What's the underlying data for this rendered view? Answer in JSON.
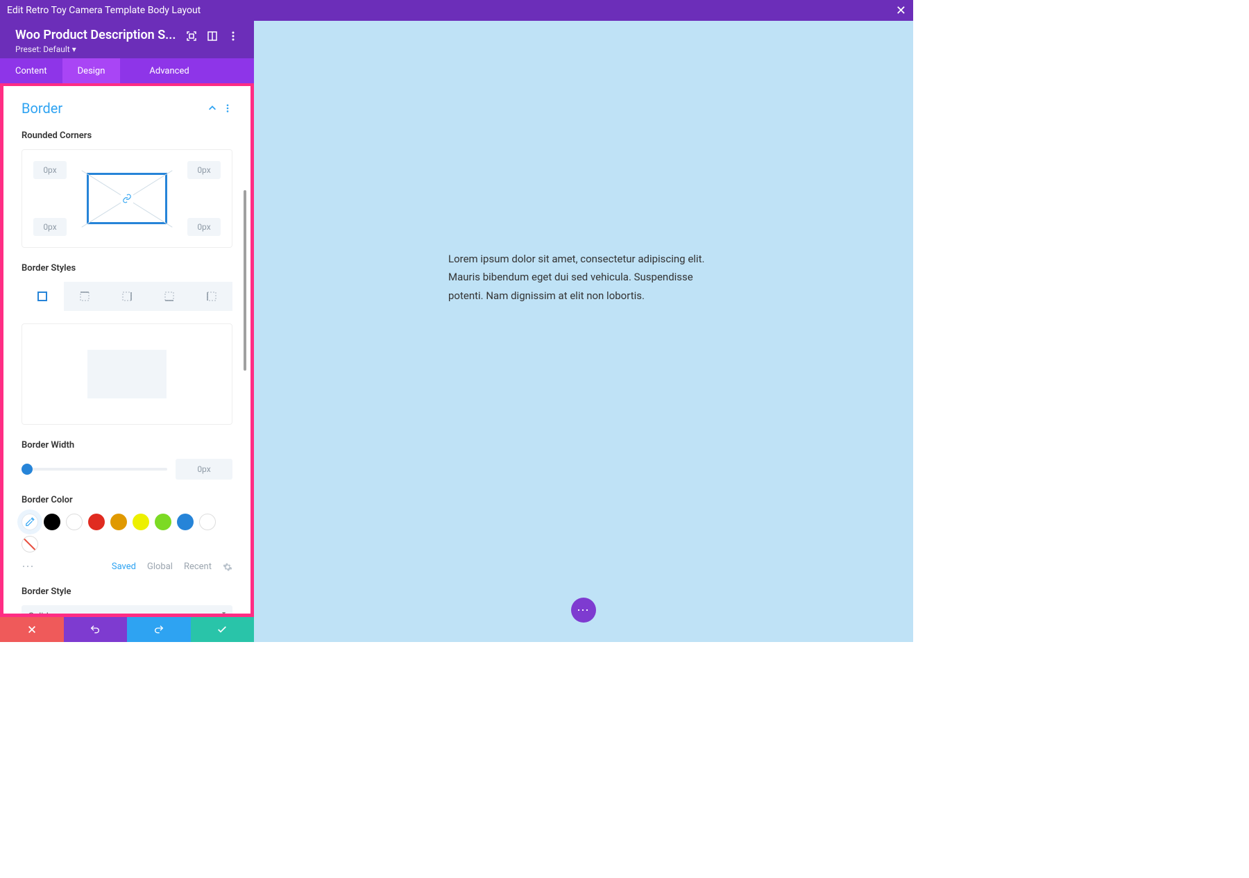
{
  "titlebar": {
    "text": "Edit Retro Toy Camera Template Body Layout"
  },
  "header": {
    "title": "Woo Product Description S...",
    "preset_label": "Preset:",
    "preset_value": "Default"
  },
  "tabs": {
    "content": "Content",
    "design": "Design",
    "advanced": "Advanced"
  },
  "section": {
    "title": "Border"
  },
  "rounded": {
    "label": "Rounded Corners",
    "tl": "0px",
    "tr": "0px",
    "bl": "0px",
    "br": "0px"
  },
  "border_styles": {
    "label": "Border Styles"
  },
  "border_width": {
    "label": "Border Width",
    "value": "0px"
  },
  "border_color": {
    "label": "Border Color",
    "swatches": [
      "#000000",
      "#ffffff",
      "#e02b20",
      "#edb059",
      "#ffe600",
      "#7cda24",
      "#2684d8",
      "#ffffff"
    ],
    "tabs": {
      "saved": "Saved",
      "global": "Global",
      "recent": "Recent"
    }
  },
  "border_style": {
    "label": "Border Style",
    "value": "Solid"
  },
  "canvas": {
    "text": "Lorem ipsum dolor sit amet, consectetur adipiscing elit. Mauris bibendum eget dui sed vehicula. Suspendisse potenti. Nam dignissim at elit non lobortis."
  }
}
